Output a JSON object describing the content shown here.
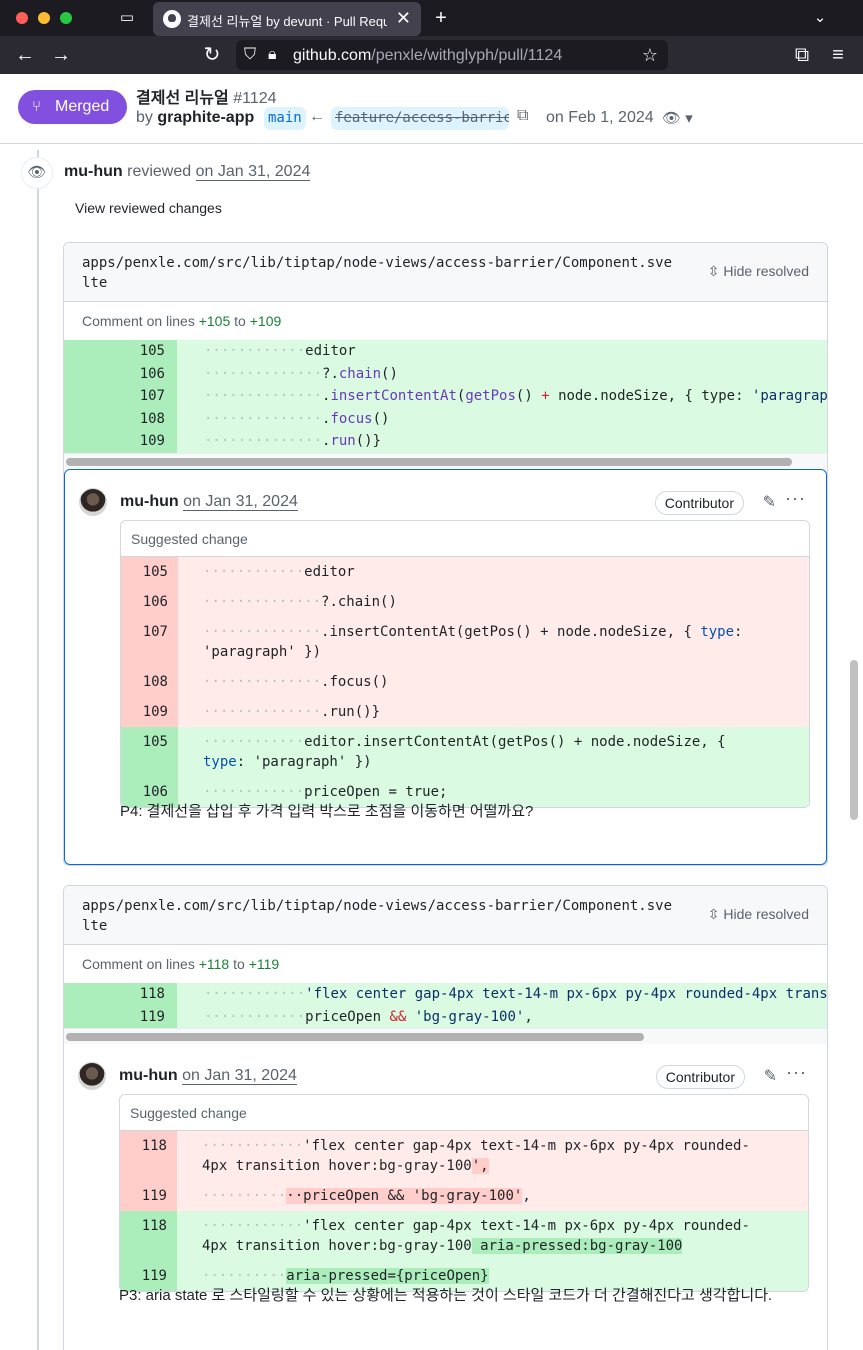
{
  "browser": {
    "tab_title": "결제선 리뉴얼 by devunt · Pull Request",
    "url_host": "github.com",
    "url_path": "/penxle/withglyph/pull/1124"
  },
  "pr": {
    "state_label": "Merged",
    "title": "결제선 리뉴얼",
    "number": "#1124",
    "by_prefix": "by",
    "author": "graphite-app",
    "base_branch": "main",
    "head_branch": "feature/access-barrier",
    "date": "on Feb 1, 2024"
  },
  "review": {
    "reviewer": "mu-hun",
    "action": "reviewed",
    "date": "on Jan 31, 2024",
    "view_changes": "View reviewed changes"
  },
  "threads": [
    {
      "file_path": "apps/penxle.com/src/lib/tiptap/node-views/access-barrier/Component.svelte",
      "hide_resolved": "Hide resolved",
      "comment_on_prefix": "Comment on lines",
      "from_line": "+105",
      "to_word": "to",
      "to_line": "+109",
      "comment": {
        "author": "mu-hun",
        "date": "on Jan 31, 2024",
        "role": "Contributor",
        "suggest_label": "Suggested change",
        "body": "P4: 결제선을 삽입 후 가격 입력 박스로 초점을 이동하면 어떨까요?"
      }
    },
    {
      "file_path": "apps/penxle.com/src/lib/tiptap/node-views/access-barrier/Component.svelte",
      "hide_resolved": "Hide resolved",
      "comment_on_prefix": "Comment on lines",
      "from_line": "+118",
      "to_word": "to",
      "to_line": "+119",
      "comment": {
        "author": "mu-hun",
        "date": "on Jan 31, 2024",
        "role": "Contributor",
        "suggest_label": "Suggested change",
        "body": "P3: aria state 로 스타일링할 수 있는 상황에는 적용하는 것이 스타일 코드가 더 간결해진다고 생각합니다."
      }
    }
  ],
  "colors": {
    "merged": "#8250df",
    "addition_bg": "#dafbe1",
    "addition_num_bg": "#aceebb",
    "deletion_bg": "#ffebe9",
    "deletion_num_bg": "#ffcecb",
    "focus_border": "#0969da"
  },
  "icons": [
    "tab-overview-icon",
    "github-favicon-icon",
    "close-icon",
    "new-tab-icon",
    "chevron-down-icon",
    "back-arrow-icon",
    "forward-arrow-icon",
    "reload-icon",
    "shield-icon",
    "lock-icon",
    "star-icon",
    "extensions-icon",
    "menu-icon",
    "git-merge-icon",
    "left-arrow-icon",
    "copy-icon",
    "eye-icon",
    "fold-icon",
    "pencil-icon",
    "kebab-icon"
  ]
}
